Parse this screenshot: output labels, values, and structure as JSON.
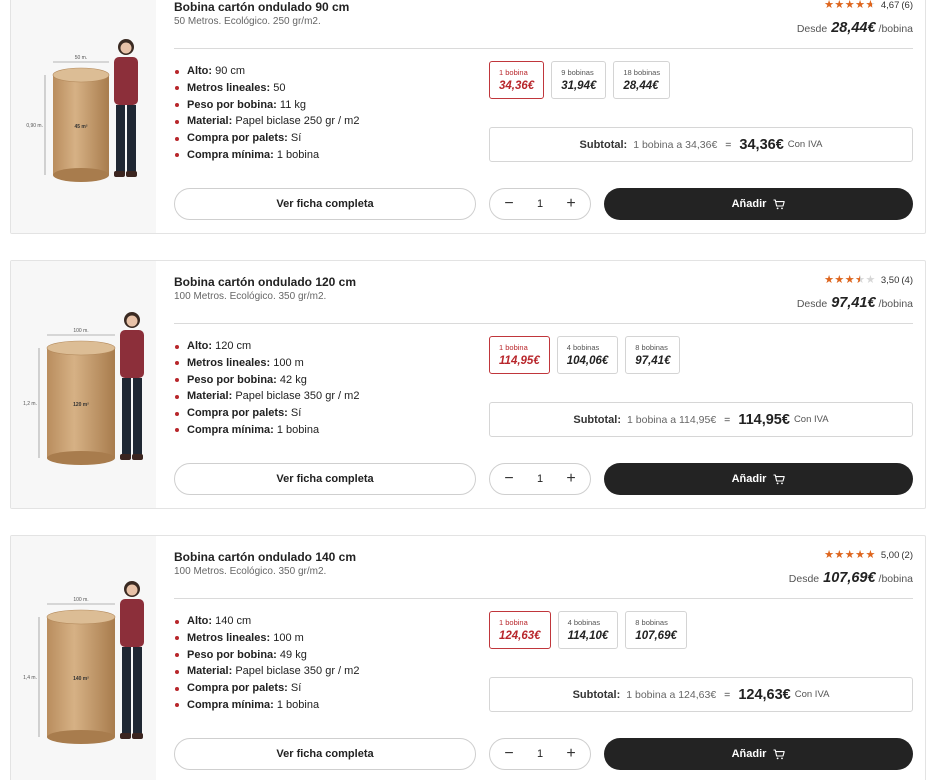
{
  "products": [
    {
      "title": "Bobina cartón ondulado 90 cm",
      "subtitle": "50 Metros. Ecológico. 250 gr/m2.",
      "rating": {
        "stars": 4.67,
        "value": "4,67",
        "count": "(6)"
      },
      "from": {
        "label": "Desde",
        "price": "28,44€",
        "unit": "/bobina"
      },
      "image": {
        "width_label": "50 m.",
        "height_label": "0,90 m.",
        "area_label": "45 m²"
      },
      "specs": [
        {
          "k": "Alto:",
          "v": "90 cm"
        },
        {
          "k": "Metros lineales:",
          "v": "50"
        },
        {
          "k": "Peso por bobina:",
          "v": "11 kg"
        },
        {
          "k": "Material:",
          "v": "Papel biclase 250 gr / m2"
        },
        {
          "k": "Compra por palets:",
          "v": "Sí"
        },
        {
          "k": "Compra mínima:",
          "v": "1 bobina"
        }
      ],
      "options": [
        {
          "label": "1 bobina",
          "price": "34,36€",
          "selected": true
        },
        {
          "label": "9 bobinas",
          "price": "31,94€",
          "selected": false
        },
        {
          "label": "18 bobinas",
          "price": "28,44€",
          "selected": false
        }
      ],
      "subtotal": {
        "label": "Subtotal:",
        "detail": "1 bobina a 34,36€",
        "eq": "=",
        "total": "34,36€",
        "tax": "Con IVA"
      },
      "ficha": "Ver ficha completa",
      "qty": "1",
      "add": "Añadir"
    },
    {
      "title": "Bobina cartón ondulado 120 cm",
      "subtitle": "100 Metros. Ecológico. 350 gr/m2.",
      "rating": {
        "stars": 3.5,
        "value": "3,50",
        "count": "(4)"
      },
      "from": {
        "label": "Desde",
        "price": "97,41€",
        "unit": "/bobina"
      },
      "image": {
        "width_label": "100 m.",
        "height_label": "1,2 m.",
        "area_label": "120 m²"
      },
      "specs": [
        {
          "k": "Alto:",
          "v": "120 cm"
        },
        {
          "k": "Metros lineales:",
          "v": "100 m"
        },
        {
          "k": "Peso por bobina:",
          "v": "42 kg"
        },
        {
          "k": "Material:",
          "v": "Papel biclase 350 gr / m2"
        },
        {
          "k": "Compra por palets:",
          "v": "Sí"
        },
        {
          "k": "Compra mínima:",
          "v": "1 bobina"
        }
      ],
      "options": [
        {
          "label": "1 bobina",
          "price": "114,95€",
          "selected": true
        },
        {
          "label": "4 bobinas",
          "price": "104,06€",
          "selected": false
        },
        {
          "label": "8 bobinas",
          "price": "97,41€",
          "selected": false
        }
      ],
      "subtotal": {
        "label": "Subtotal:",
        "detail": "1 bobina a 114,95€",
        "eq": "=",
        "total": "114,95€",
        "tax": "Con IVA"
      },
      "ficha": "Ver ficha completa",
      "qty": "1",
      "add": "Añadir"
    },
    {
      "title": "Bobina cartón ondulado 140 cm",
      "subtitle": "100 Metros. Ecológico. 350 gr/m2.",
      "rating": {
        "stars": 5.0,
        "value": "5,00",
        "count": "(2)"
      },
      "from": {
        "label": "Desde",
        "price": "107,69€",
        "unit": "/bobina"
      },
      "image": {
        "width_label": "100 m.",
        "height_label": "1,4 m.",
        "area_label": "140 m²"
      },
      "specs": [
        {
          "k": "Alto:",
          "v": "140 cm"
        },
        {
          "k": "Metros lineales:",
          "v": "100 m"
        },
        {
          "k": "Peso por bobina:",
          "v": "49 kg"
        },
        {
          "k": "Material:",
          "v": "Papel biclase 350 gr / m2"
        },
        {
          "k": "Compra por palets:",
          "v": "Sí"
        },
        {
          "k": "Compra mínima:",
          "v": "1 bobina"
        }
      ],
      "options": [
        {
          "label": "1 bobina",
          "price": "124,63€",
          "selected": true
        },
        {
          "label": "4 bobinas",
          "price": "114,10€",
          "selected": false
        },
        {
          "label": "8 bobinas",
          "price": "107,69€",
          "selected": false
        }
      ],
      "subtotal": {
        "label": "Subtotal:",
        "detail": "1 bobina a 124,63€",
        "eq": "=",
        "total": "124,63€",
        "tax": "Con IVA"
      },
      "ficha": "Ver ficha completa",
      "qty": "1",
      "add": "Añadir"
    }
  ],
  "colors": {
    "accent": "#b8262b",
    "star": "#e0651c",
    "button_dark": "#232323",
    "roll": "#c9a174"
  },
  "icons": {
    "star": "star-icon",
    "cart": "cart-icon",
    "minus": "minus-icon",
    "plus": "plus-icon"
  }
}
